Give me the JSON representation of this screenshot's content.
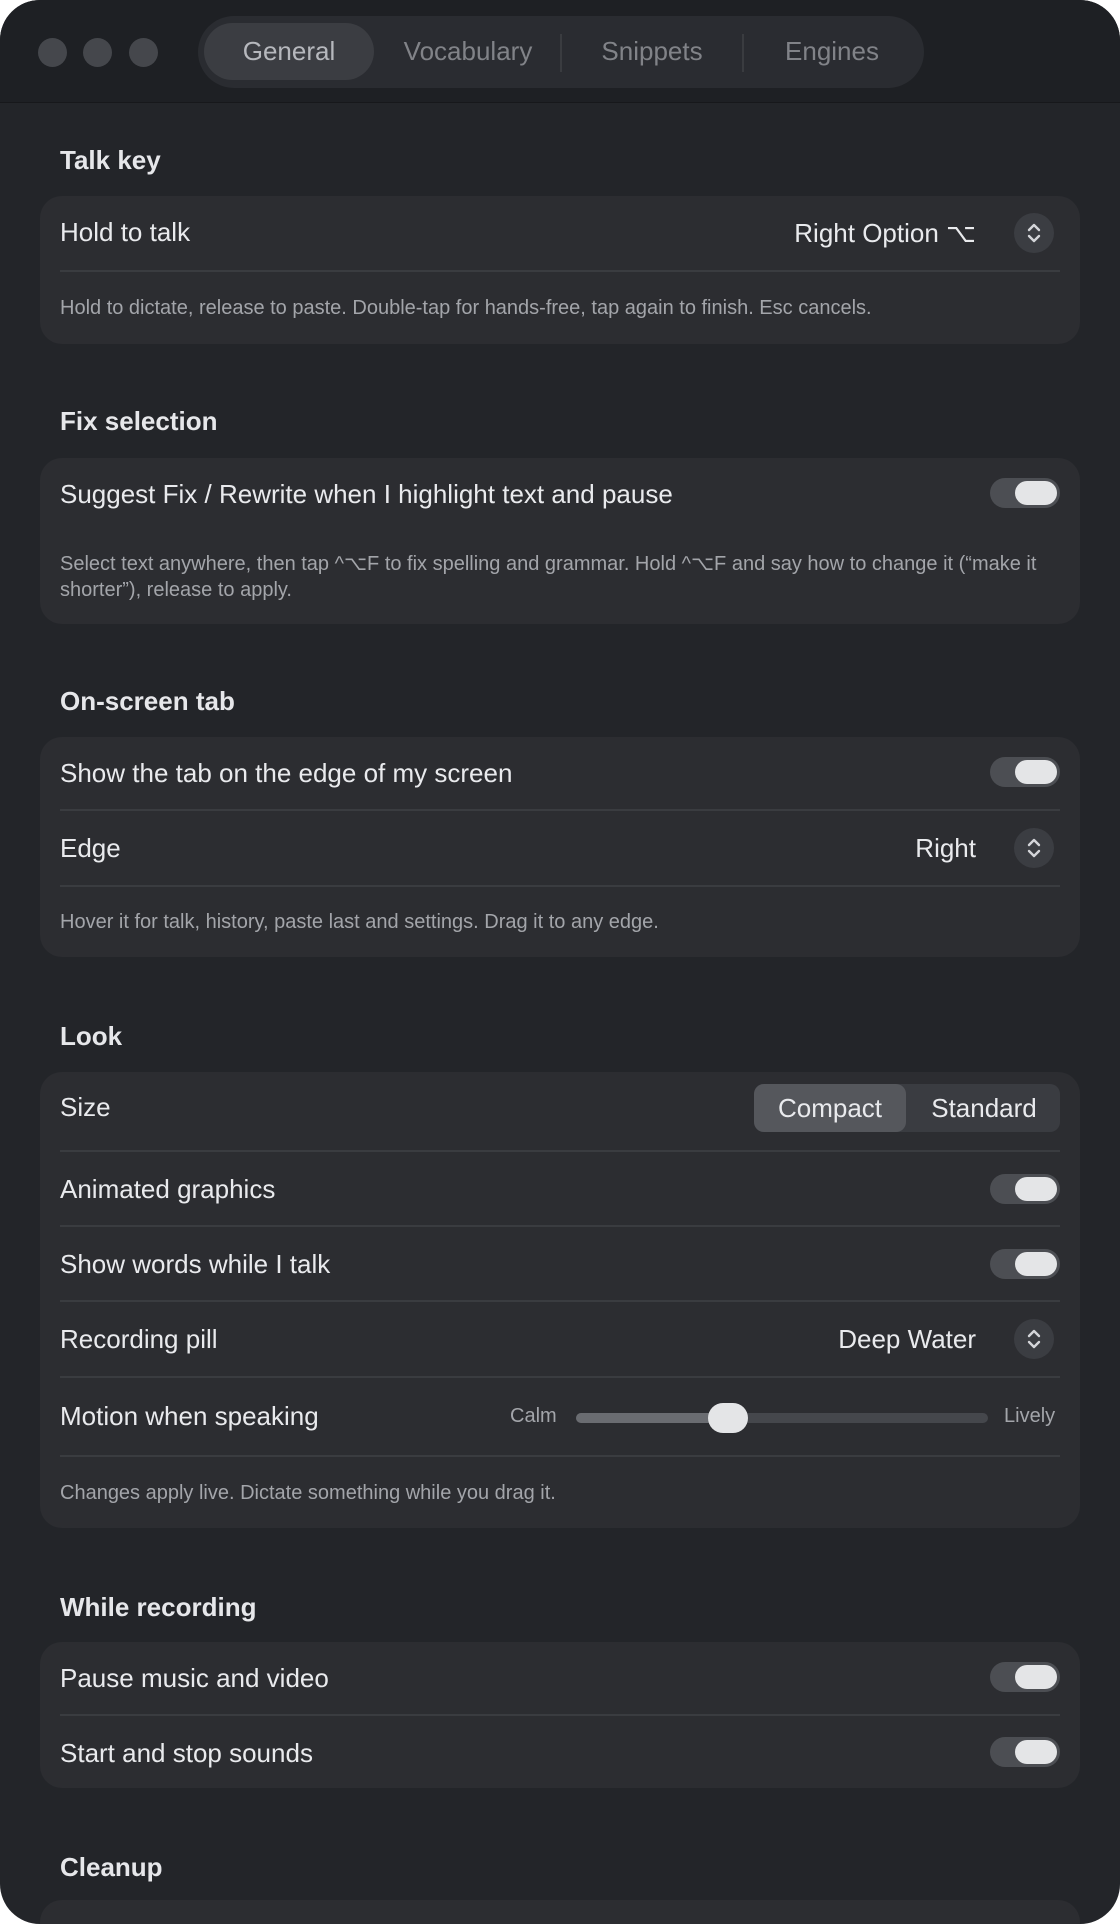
{
  "tabs": {
    "general": "General",
    "vocabulary": "Vocabulary",
    "snippets": "Snippets",
    "engines": "Engines"
  },
  "talk_key": {
    "title": "Talk key",
    "hold_label": "Hold to talk",
    "hold_value": "Right Option ⌥",
    "desc": "Hold to dictate, release to paste. Double-tap for hands-free, tap again to finish. Esc cancels."
  },
  "fix_selection": {
    "title": "Fix selection",
    "suggest_label": "Suggest Fix / Rewrite when I highlight text and pause",
    "suggest_on": true,
    "desc": "Select text anywhere, then tap ^⌥F to fix spelling and grammar. Hold ^⌥F and say how to change it (“make it shorter”), release to apply."
  },
  "onscreen_tab": {
    "title": "On-screen tab",
    "show_label": "Show the tab on the edge of my screen",
    "show_on": true,
    "edge_label": "Edge",
    "edge_value": "Right",
    "desc": "Hover it for talk, history, paste last and settings. Drag it to any edge."
  },
  "look": {
    "title": "Look",
    "size_label": "Size",
    "size_options": [
      "Compact",
      "Standard"
    ],
    "size_selected": "Compact",
    "animated_label": "Animated graphics",
    "animated_on": true,
    "words_label": "Show words while I talk",
    "words_on": true,
    "pill_label": "Recording pill",
    "pill_value": "Deep Water",
    "motion_label": "Motion when speaking",
    "motion_min": "Calm",
    "motion_max": "Lively",
    "motion_level": 0.37,
    "desc": "Changes apply live. Dictate something while you drag it."
  },
  "while_recording": {
    "title": "While recording",
    "pause_label": "Pause music and video",
    "pause_on": true,
    "sounds_label": "Start and stop sounds",
    "sounds_on": true
  },
  "cleanup": {
    "title": "Cleanup"
  }
}
